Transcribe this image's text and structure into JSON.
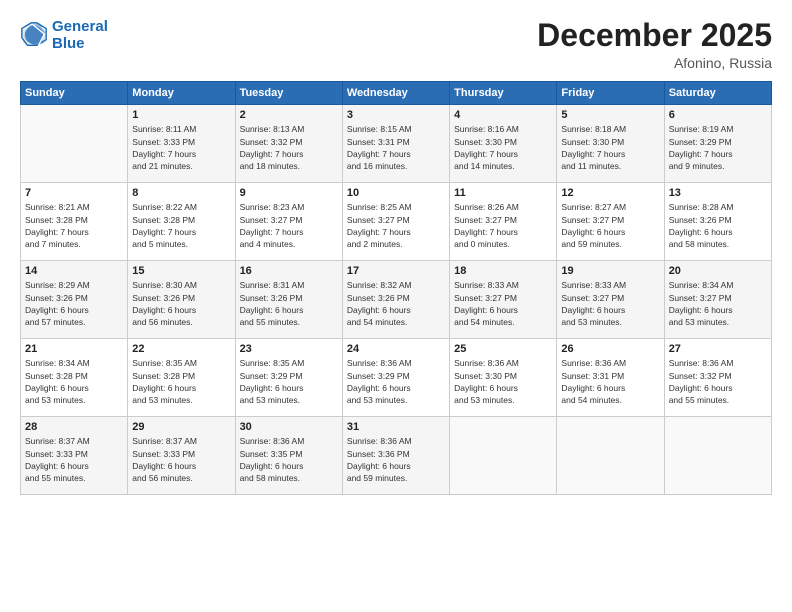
{
  "logo": {
    "line1": "General",
    "line2": "Blue"
  },
  "title": "December 2025",
  "location": "Afonino, Russia",
  "header_days": [
    "Sunday",
    "Monday",
    "Tuesday",
    "Wednesday",
    "Thursday",
    "Friday",
    "Saturday"
  ],
  "weeks": [
    [
      {
        "day": "",
        "info": ""
      },
      {
        "day": "1",
        "info": "Sunrise: 8:11 AM\nSunset: 3:33 PM\nDaylight: 7 hours\nand 21 minutes."
      },
      {
        "day": "2",
        "info": "Sunrise: 8:13 AM\nSunset: 3:32 PM\nDaylight: 7 hours\nand 18 minutes."
      },
      {
        "day": "3",
        "info": "Sunrise: 8:15 AM\nSunset: 3:31 PM\nDaylight: 7 hours\nand 16 minutes."
      },
      {
        "day": "4",
        "info": "Sunrise: 8:16 AM\nSunset: 3:30 PM\nDaylight: 7 hours\nand 14 minutes."
      },
      {
        "day": "5",
        "info": "Sunrise: 8:18 AM\nSunset: 3:30 PM\nDaylight: 7 hours\nand 11 minutes."
      },
      {
        "day": "6",
        "info": "Sunrise: 8:19 AM\nSunset: 3:29 PM\nDaylight: 7 hours\nand 9 minutes."
      }
    ],
    [
      {
        "day": "7",
        "info": "Sunrise: 8:21 AM\nSunset: 3:28 PM\nDaylight: 7 hours\nand 7 minutes."
      },
      {
        "day": "8",
        "info": "Sunrise: 8:22 AM\nSunset: 3:28 PM\nDaylight: 7 hours\nand 5 minutes."
      },
      {
        "day": "9",
        "info": "Sunrise: 8:23 AM\nSunset: 3:27 PM\nDaylight: 7 hours\nand 4 minutes."
      },
      {
        "day": "10",
        "info": "Sunrise: 8:25 AM\nSunset: 3:27 PM\nDaylight: 7 hours\nand 2 minutes."
      },
      {
        "day": "11",
        "info": "Sunrise: 8:26 AM\nSunset: 3:27 PM\nDaylight: 7 hours\nand 0 minutes."
      },
      {
        "day": "12",
        "info": "Sunrise: 8:27 AM\nSunset: 3:27 PM\nDaylight: 6 hours\nand 59 minutes."
      },
      {
        "day": "13",
        "info": "Sunrise: 8:28 AM\nSunset: 3:26 PM\nDaylight: 6 hours\nand 58 minutes."
      }
    ],
    [
      {
        "day": "14",
        "info": "Sunrise: 8:29 AM\nSunset: 3:26 PM\nDaylight: 6 hours\nand 57 minutes."
      },
      {
        "day": "15",
        "info": "Sunrise: 8:30 AM\nSunset: 3:26 PM\nDaylight: 6 hours\nand 56 minutes."
      },
      {
        "day": "16",
        "info": "Sunrise: 8:31 AM\nSunset: 3:26 PM\nDaylight: 6 hours\nand 55 minutes."
      },
      {
        "day": "17",
        "info": "Sunrise: 8:32 AM\nSunset: 3:26 PM\nDaylight: 6 hours\nand 54 minutes."
      },
      {
        "day": "18",
        "info": "Sunrise: 8:33 AM\nSunset: 3:27 PM\nDaylight: 6 hours\nand 54 minutes."
      },
      {
        "day": "19",
        "info": "Sunrise: 8:33 AM\nSunset: 3:27 PM\nDaylight: 6 hours\nand 53 minutes."
      },
      {
        "day": "20",
        "info": "Sunrise: 8:34 AM\nSunset: 3:27 PM\nDaylight: 6 hours\nand 53 minutes."
      }
    ],
    [
      {
        "day": "21",
        "info": "Sunrise: 8:34 AM\nSunset: 3:28 PM\nDaylight: 6 hours\nand 53 minutes."
      },
      {
        "day": "22",
        "info": "Sunrise: 8:35 AM\nSunset: 3:28 PM\nDaylight: 6 hours\nand 53 minutes."
      },
      {
        "day": "23",
        "info": "Sunrise: 8:35 AM\nSunset: 3:29 PM\nDaylight: 6 hours\nand 53 minutes."
      },
      {
        "day": "24",
        "info": "Sunrise: 8:36 AM\nSunset: 3:29 PM\nDaylight: 6 hours\nand 53 minutes."
      },
      {
        "day": "25",
        "info": "Sunrise: 8:36 AM\nSunset: 3:30 PM\nDaylight: 6 hours\nand 53 minutes."
      },
      {
        "day": "26",
        "info": "Sunrise: 8:36 AM\nSunset: 3:31 PM\nDaylight: 6 hours\nand 54 minutes."
      },
      {
        "day": "27",
        "info": "Sunrise: 8:36 AM\nSunset: 3:32 PM\nDaylight: 6 hours\nand 55 minutes."
      }
    ],
    [
      {
        "day": "28",
        "info": "Sunrise: 8:37 AM\nSunset: 3:33 PM\nDaylight: 6 hours\nand 55 minutes."
      },
      {
        "day": "29",
        "info": "Sunrise: 8:37 AM\nSunset: 3:33 PM\nDaylight: 6 hours\nand 56 minutes."
      },
      {
        "day": "30",
        "info": "Sunrise: 8:36 AM\nSunset: 3:35 PM\nDaylight: 6 hours\nand 58 minutes."
      },
      {
        "day": "31",
        "info": "Sunrise: 8:36 AM\nSunset: 3:36 PM\nDaylight: 6 hours\nand 59 minutes."
      },
      {
        "day": "",
        "info": ""
      },
      {
        "day": "",
        "info": ""
      },
      {
        "day": "",
        "info": ""
      }
    ]
  ]
}
